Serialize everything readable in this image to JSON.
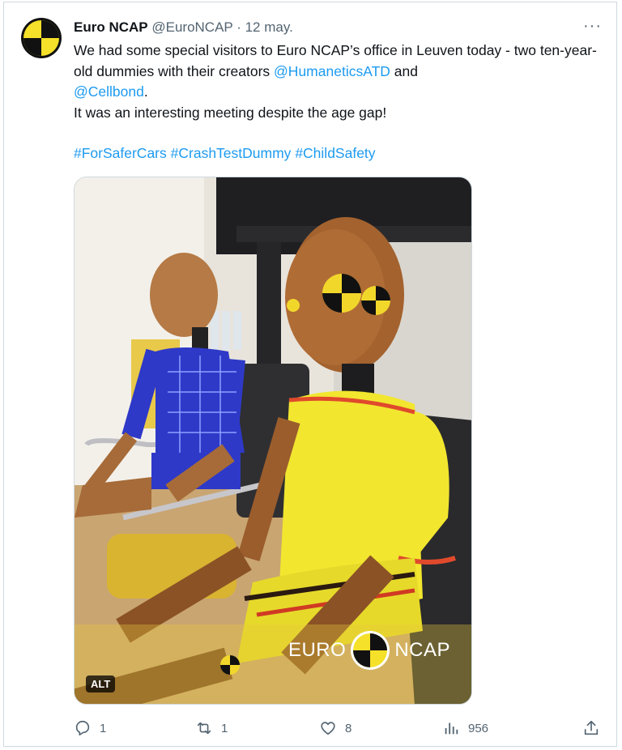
{
  "tweet": {
    "author_name": "Euro NCAP",
    "handle": "@EuroNCAP",
    "separator": "·",
    "date": "12 may.",
    "more_label": "···",
    "text_line1": "We had some special visitors to Euro NCAP’s office in Leuven today - two ten-year-old dummies with their creators ",
    "mention1": "@HumaneticsATD",
    "and_text": " and ",
    "mention2": "@Cellbond",
    "period": ".",
    "text_line2": "It was an interesting meeting despite the age gap!",
    "hashtags": [
      "#ForSaferCars",
      "#CrashTestDummy",
      "#ChildSafety"
    ],
    "media": {
      "alt_label": "ALT",
      "watermark_left": "EURO",
      "watermark_right": "NCAP"
    },
    "actions": {
      "reply_count": "1",
      "retweet_count": "1",
      "like_count": "8",
      "views_count": "956"
    }
  },
  "colors": {
    "link": "#1d9bf0",
    "muted": "#536471",
    "logo_yellow": "#f5e02a"
  }
}
